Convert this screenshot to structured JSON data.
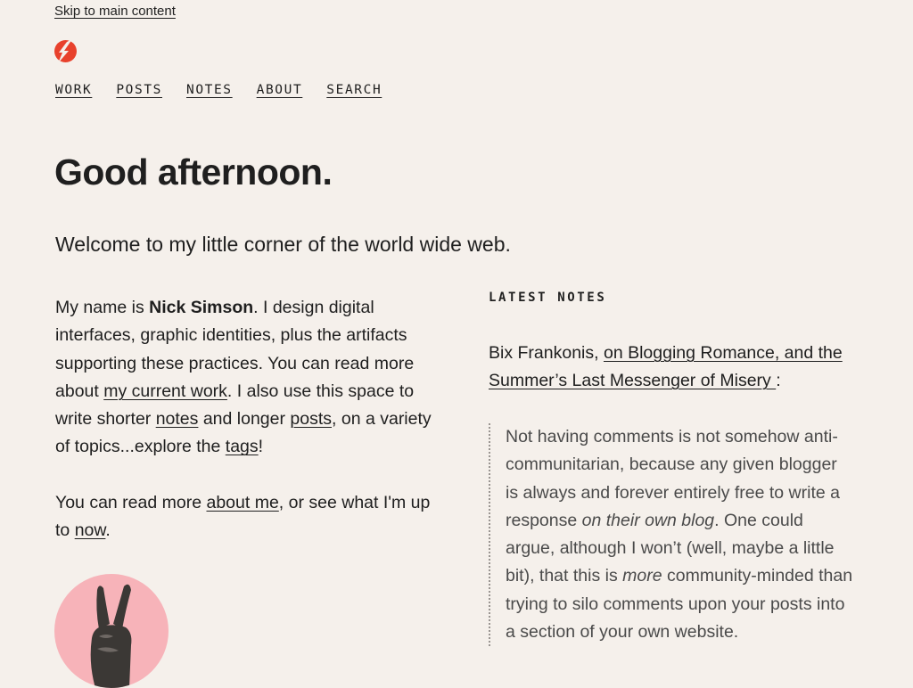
{
  "skip_link": "Skip to main content",
  "logo": {
    "icon": "lightning-bolt-logo",
    "color": "#e8412c"
  },
  "nav": [
    {
      "label": "WORK"
    },
    {
      "label": "POSTS"
    },
    {
      "label": "NOTES"
    },
    {
      "label": "ABOUT"
    },
    {
      "label": "SEARCH"
    }
  ],
  "greeting": "Good afternoon.",
  "lead": "Welcome to my little corner of the world wide web.",
  "intro": {
    "t1": "My name is ",
    "name": "Nick Simson",
    "t2": ". I design digital interfaces, graphic identities, plus the artifacts supporting these practices. You can read more about ",
    "link_work": "my current work",
    "t3": ". I also use this space to write shorter ",
    "link_notes": "notes",
    "t4": " and longer ",
    "link_posts": "posts",
    "t5": ", on a variety of topics...explore the ",
    "link_tags": "tags",
    "t6": "!"
  },
  "more": {
    "t1": "You can read more ",
    "link_about": "about me",
    "t2": ", or see what I'm up to ",
    "link_now": "now",
    "t3": "."
  },
  "avatar": {
    "icon": "peace-sign-hand-image",
    "bg": "#f7b3b9"
  },
  "latest_notes": {
    "label": "LATEST NOTES",
    "author": "Bix Frankonis, ",
    "link": "on Blogging Romance, and the Summer’s Last Messenger of Misery ",
    "colon": ":",
    "quote": {
      "q1": "Not having comments is not somehow anti-communitarian, because any given blogger is always and forever entirely free to write a response ",
      "q1_em": "on their own blog",
      "q2": ". One could argue, although I won’t (well, maybe a little bit), that this is ",
      "q2_em": "more",
      "q3": " community-minded than trying to silo comments upon your posts into a section of your own website."
    }
  }
}
